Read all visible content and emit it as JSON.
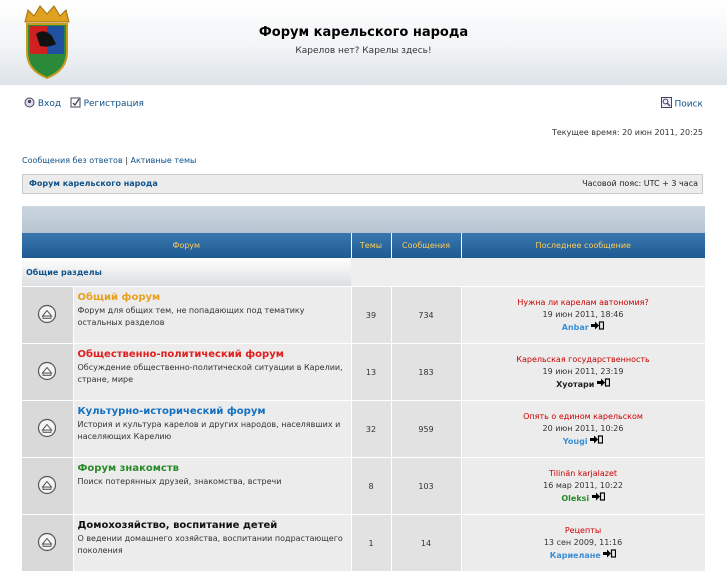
{
  "header": {
    "title": "Форум карельского народа",
    "description": "Карелов нет? Карелы здесь!"
  },
  "nav": {
    "login": "Вход",
    "register": "Регистрация",
    "search": "Поиск"
  },
  "current_time": "Текущее время: 20 июн 2011, 20:25",
  "quick_links": {
    "unanswered": "Сообщения без ответов",
    "separator": "|",
    "active": "Активные темы"
  },
  "breadcrumb": {
    "home": "Форум карельского народа",
    "timezone": "Часовой пояс: UTC + 3 часа"
  },
  "table": {
    "headers": [
      "Форум",
      "Темы",
      "Сообщения",
      "Последнее сообщение"
    ],
    "category": "Общие разделы",
    "forums": [
      {
        "name": "Общий форум",
        "name_color": "#e8a020",
        "desc": "Форум для общих тем, не попадающих под тематику остальных разделов",
        "topics": "39",
        "posts": "734",
        "last_title": "Нужна ли карелам автономия?",
        "last_date": "19 июн 2011, 18:46",
        "last_author": "Anbar",
        "author_color": "#3b8fd6"
      },
      {
        "name": "Общественно-политический форум",
        "name_color": "#e02020",
        "desc": "Обсуждение общественно-политической ситуации в Карелии, стране, мире",
        "topics": "13",
        "posts": "183",
        "last_title": "Карельская государственность",
        "last_date": "19 июн 2011, 23:19",
        "last_author": "Хуотари",
        "author_color": "#222222"
      },
      {
        "name": "Культурно-исторический форум",
        "name_color": "#1570c0",
        "desc": "История и культура карелов и других народов, населявших и населяющих Карелию",
        "topics": "32",
        "posts": "959",
        "last_title": "Опять о едином карельском",
        "last_date": "20 июн 2011, 10:26",
        "last_author": "Yougi",
        "author_color": "#3b8fd6"
      },
      {
        "name": "Форум знакомств",
        "name_color": "#2a8a2a",
        "desc": "Поиск потерянных друзей, знакомства, встречи",
        "topics": "8",
        "posts": "103",
        "last_title": "Tilinän karjalazet",
        "last_date": "16 мар 2011, 10:22",
        "last_author": "Oleksi",
        "author_color": "#2a8a2a"
      },
      {
        "name": "Домохозяйство, воспитание детей",
        "name_color": "#111111",
        "desc": "О ведении домашнего хозяйства, воспитании подрастающего поколения",
        "topics": "1",
        "posts": "14",
        "last_title": "Рецепты",
        "last_date": "13 сен 2009, 11:16",
        "last_author": "Кариелане",
        "author_color": "#3b8fd6"
      }
    ]
  },
  "icons": {
    "logo": "karelia-coat-of-arms",
    "login": "login-icon",
    "register": "register-icon",
    "search": "search-icon",
    "forum": "forum-read-icon",
    "goto": "goto-last-post-icon"
  },
  "colors": {
    "header_bar": "#1e5a92",
    "header_text": "#ffcc55",
    "link": "#105289",
    "last_post_title": "#cc0000"
  }
}
